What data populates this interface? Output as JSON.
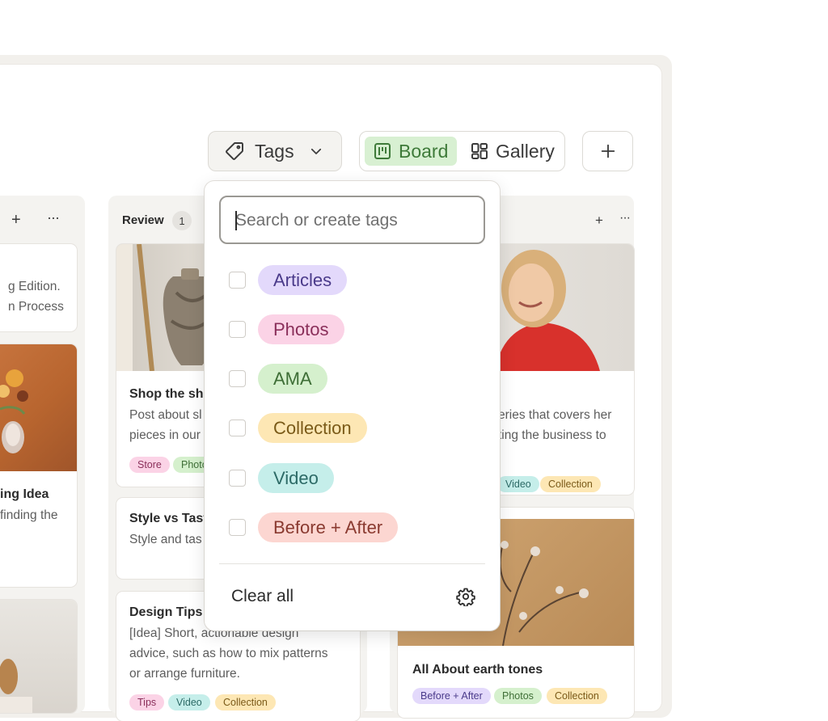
{
  "toolbar": {
    "tags_label": "Tags",
    "board_label": "Board",
    "gallery_label": "Gallery"
  },
  "columns": {
    "left": {
      "cards": [
        {
          "desc": [
            "g Edition.",
            "n Process"
          ]
        },
        {
          "title": "ing Idea",
          "desc": [
            "finding the"
          ]
        }
      ]
    },
    "review": {
      "label": "Review",
      "count": "1",
      "cards": [
        {
          "title": "Shop the sho",
          "desc": [
            "Post about sl",
            "pieces in our"
          ],
          "tags": [
            "Store",
            "Photo"
          ]
        },
        {
          "title": "Style vs Tast",
          "desc": [
            "Style and tas"
          ]
        },
        {
          "title": "Design Tips i",
          "desc": [
            "[Idea] Short, actionable design",
            "advice, such as how to mix patterns",
            "or arrange furniture."
          ],
          "tags": [
            "Tips",
            "Video",
            "Collection"
          ]
        }
      ]
    },
    "right": {
      "cards": [
        {
          "desc": [
            "eries that covers her",
            "ting the business to"
          ],
          "tags": [
            "Video",
            "Collection"
          ]
        },
        {
          "title": "All About earth tones",
          "tags": [
            "Before + After",
            "Photos",
            "Collection"
          ]
        }
      ]
    }
  },
  "dropdown": {
    "search_placeholder": "Search or create tags",
    "tags": [
      {
        "label": "Articles",
        "bg": "#e3d9fb",
        "fg": "#4a3a8a"
      },
      {
        "label": "Photos",
        "bg": "#fbd3e6",
        "fg": "#8a2f5a"
      },
      {
        "label": "AMA",
        "bg": "#d5f0cd",
        "fg": "#3e6e36"
      },
      {
        "label": "Collection",
        "bg": "#fde7b4",
        "fg": "#7a5a18"
      },
      {
        "label": "Video",
        "bg": "#c5eeea",
        "fg": "#2c6a66"
      },
      {
        "label": "Before + After",
        "bg": "#fcd6d1",
        "fg": "#8a3a30"
      }
    ],
    "clear_label": "Clear all"
  },
  "colors": {
    "accent_green": "#3e7a39",
    "board_active_bg": "#d8f0d2"
  },
  "icons": [
    "tag-icon",
    "chevron-down-icon",
    "board-icon",
    "gallery-icon",
    "plus-icon",
    "more-icon",
    "gear-icon"
  ]
}
